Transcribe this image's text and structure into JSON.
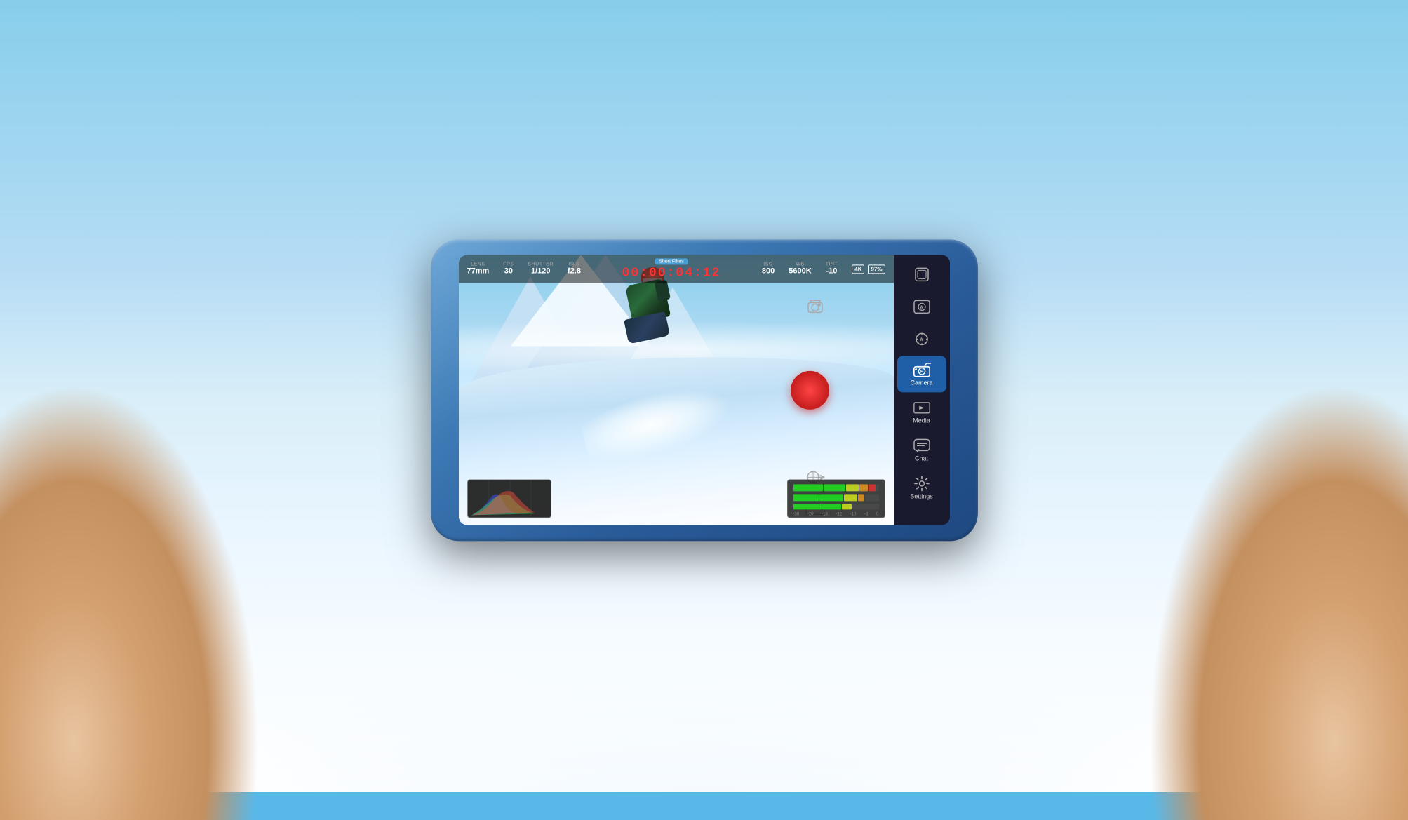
{
  "background": {
    "sky_color_top": "#87ceeb",
    "sky_color_bottom": "#5ab8e8"
  },
  "phone": {
    "color": "#3d7ab5"
  },
  "hud": {
    "lens_label": "LENS",
    "lens_value": "77mm",
    "fps_label": "FPS",
    "fps_value": "30",
    "shutter_label": "SHUTTER",
    "shutter_value": "1/120",
    "iris_label": "IRIS",
    "iris_value": "f2.8",
    "film_mode": "Short Films",
    "timer": "00:00:04:12",
    "timer_color": "#ff3333",
    "iso_label": "ISO",
    "iso_value": "800",
    "wb_label": "WB",
    "wb_value": "5600K",
    "tint_label": "TINT",
    "tint_value": "-10",
    "badge_4k": "4K",
    "battery": "97%"
  },
  "sidebar": {
    "items": [
      {
        "id": "grid",
        "label": "",
        "icon": "grid-icon",
        "active": false
      },
      {
        "id": "auto-focus",
        "label": "",
        "icon": "autofocus-icon",
        "active": false
      },
      {
        "id": "auto-exposure",
        "label": "",
        "icon": "autoexposure-icon",
        "active": false
      },
      {
        "id": "camera",
        "label": "Camera",
        "icon": "camera-icon",
        "active": true
      },
      {
        "id": "media",
        "label": "Media",
        "icon": "media-icon",
        "active": false
      },
      {
        "id": "chat",
        "label": "Chat",
        "icon": "chat-icon",
        "active": false
      },
      {
        "id": "settings",
        "label": "Settings",
        "icon": "settings-icon",
        "active": false
      }
    ]
  },
  "controls": {
    "record_button": "record",
    "focus_button": "focus-zoom",
    "remote_button": "remote-camera",
    "clapper_button": "clapper"
  },
  "histogram": {
    "visible": true
  },
  "audio_meter": {
    "visible": true,
    "labels": [
      "-30",
      "-20",
      "-18",
      "-12",
      "-10",
      "-6",
      "0"
    ]
  }
}
